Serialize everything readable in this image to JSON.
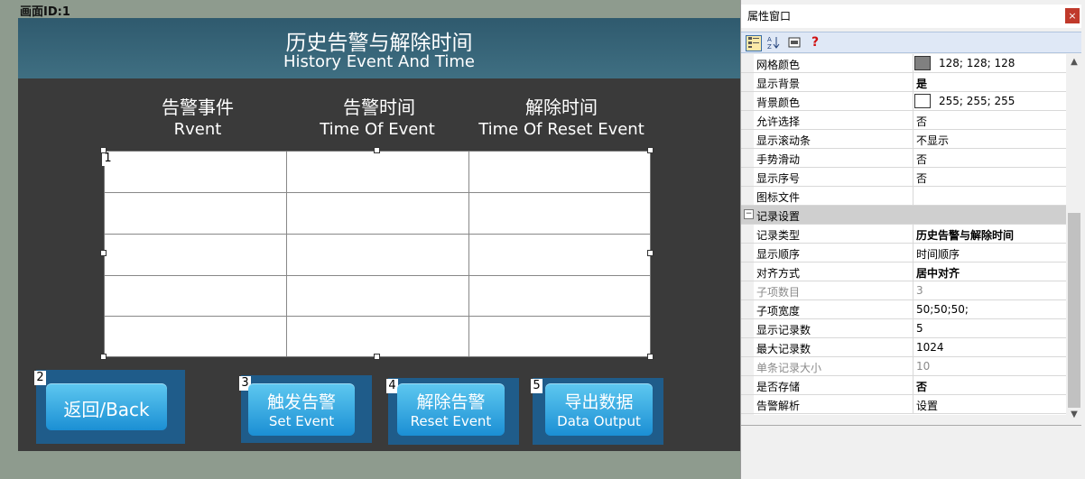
{
  "canvas": {
    "label": "画面ID:1"
  },
  "screen": {
    "title_cn": "历史告警与解除时间",
    "title_en": "History Event And Time",
    "columns": [
      {
        "cn": "告警事件",
        "en": "Rvent"
      },
      {
        "cn": "告警时间",
        "en": "Time Of Event"
      },
      {
        "cn": "解除时间",
        "en": "Time Of Reset Event"
      }
    ],
    "table_index": "1",
    "buttons": [
      {
        "index": "2",
        "label": "返回/Back"
      },
      {
        "index": "3",
        "cn": "触发告警",
        "en": "Set Event"
      },
      {
        "index": "4",
        "cn": "解除告警",
        "en": "Reset Event"
      },
      {
        "index": "5",
        "cn": "导出数据",
        "en": "Data Output"
      }
    ]
  },
  "property_window": {
    "title": "属性窗口",
    "close": "×",
    "toolbar": {
      "icons": [
        "categorized-icon",
        "sort-alpha-icon",
        "property-pages-icon",
        "help-icon"
      ],
      "help_glyph": "?"
    },
    "rows": [
      {
        "name": "网格颜色",
        "value": "128; 128; 128",
        "swatch": "#808080"
      },
      {
        "name": "显示背景",
        "value": "是",
        "bold": true
      },
      {
        "name": "背景颜色",
        "value": "255; 255; 255",
        "swatch": "#ffffff"
      },
      {
        "name": "允许选择",
        "value": "否"
      },
      {
        "name": "显示滚动条",
        "value": "不显示"
      },
      {
        "name": "手势滑动",
        "value": "否"
      },
      {
        "name": "显示序号",
        "value": "否"
      },
      {
        "name": "图标文件",
        "value": ""
      }
    ],
    "category": "记录设置",
    "rows2": [
      {
        "name": "记录类型",
        "value": "历史告警与解除时间",
        "bold": true
      },
      {
        "name": "显示顺序",
        "value": "时间顺序"
      },
      {
        "name": "对齐方式",
        "value": "居中对齐",
        "bold": true
      },
      {
        "name": "子项数目",
        "value": "3",
        "dim": true
      },
      {
        "name": "子项宽度",
        "value": "50;50;50;"
      },
      {
        "name": "显示记录数",
        "value": "5"
      },
      {
        "name": "最大记录数",
        "value": "1024"
      },
      {
        "name": "单条记录大小",
        "value": "10",
        "dim": true
      },
      {
        "name": "是否存储",
        "value": "否",
        "bold": true
      },
      {
        "name": "告警解析",
        "value": "设置"
      }
    ]
  }
}
